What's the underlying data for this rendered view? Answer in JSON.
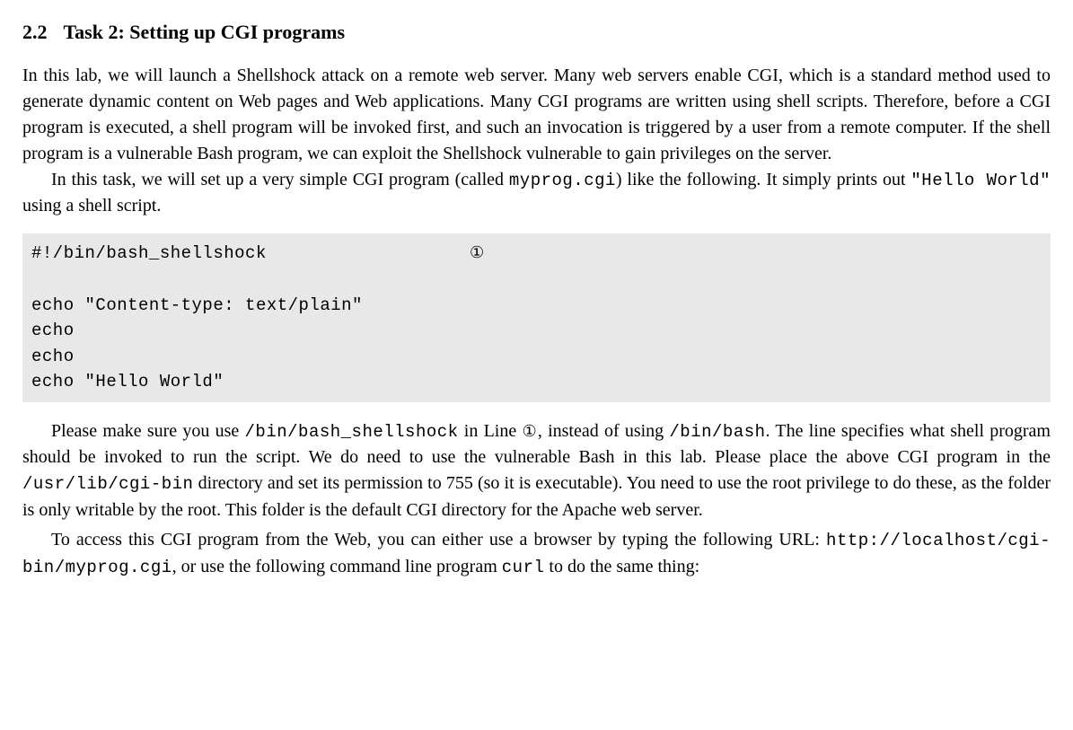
{
  "section": {
    "number": "2.2",
    "title": "Task 2: Setting up CGI programs"
  },
  "para1": "In this lab, we will launch a Shellshock attack on a remote web server.  Many web servers enable CGI, which is a standard method used to generate dynamic content on Web pages and Web applications. Many CGI programs are written using shell scripts. Therefore, before a CGI program is executed, a shell program will be invoked first, and such an invocation is triggered by a user from a remote computer.  If the shell program is a vulnerable Bash program, we can exploit the Shellshock vulnerable to gain privileges on the server.",
  "para2_parts": {
    "t1": "In this task, we will set up a very simple CGI program (called ",
    "code1": "myprog.cgi",
    "t2": ") like the following.  It simply prints out ",
    "code2": "\"Hello World\"",
    "t3": " using a shell script."
  },
  "code_block": {
    "shebang": "#!/bin/bash_shellshock",
    "marker": "①",
    "echo1": "echo \"Content-type: text/plain\"",
    "echo2": "echo",
    "echo3": "echo",
    "echo4": "echo \"Hello World\""
  },
  "para3_parts": {
    "t1": "Please make sure you use ",
    "code1": "/bin/bash_shellshock",
    "t2": " in Line ",
    "marker": "①",
    "t3": ", instead of using ",
    "code2": "/bin/bash",
    "t4": ". The line specifies what shell program should be invoked to run the script.  We do need to use the vulnerable Bash in this lab.  Please place the above CGI program in the ",
    "code3": "/usr/lib/cgi-bin",
    "t5": " directory and set its permission to 755 (so it is executable). You need to use the root privilege to do these, as the folder is only writable by the root. This folder is the default CGI directory for the Apache web server."
  },
  "para4_parts": {
    "t1": "To access this CGI program from the Web, you can either use a browser by typing the following URL: ",
    "code1": "http://localhost/cgi-bin/myprog.cgi",
    "t2": ", or use the following command line program ",
    "code2": "curl",
    "t3": " to do the same thing:"
  }
}
